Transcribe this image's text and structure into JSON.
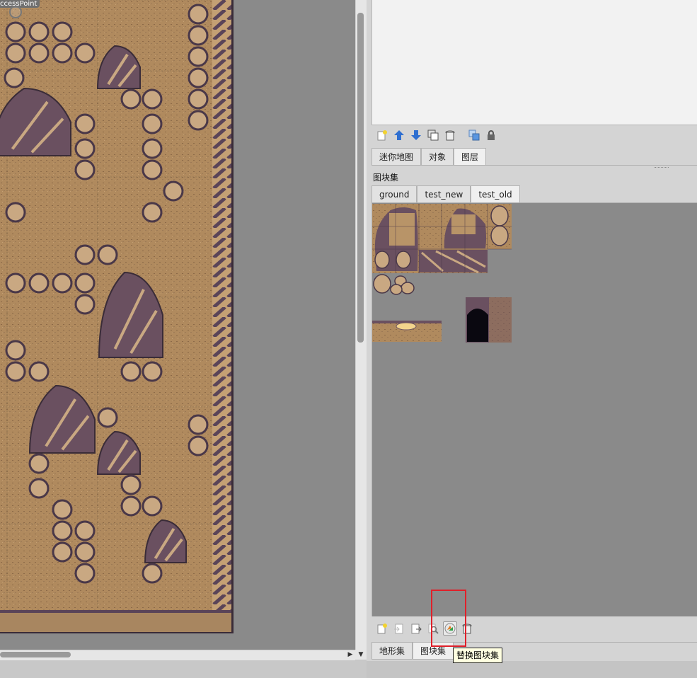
{
  "map": {
    "object_label": "ccessPoint"
  },
  "layers_toolbar": {
    "icons": [
      "new-layer-icon",
      "move-layer-up-icon",
      "move-layer-down-icon",
      "duplicate-layer-icon",
      "delete-layer-icon",
      "show-other-layers-icon",
      "lock-layer-icon"
    ]
  },
  "panel_tabs": [
    {
      "label": "迷你地图",
      "active": false
    },
    {
      "label": "对象",
      "active": false
    },
    {
      "label": "图层",
      "active": true
    }
  ],
  "tilesets": {
    "title": "图块集",
    "tabs": [
      {
        "label": "ground",
        "active": false
      },
      {
        "label": "test_new",
        "active": false
      },
      {
        "label": "test_old",
        "active": true
      }
    ]
  },
  "tileset_toolbar": {
    "icons": [
      "new-tileset-icon",
      "import-tileset-icon",
      "export-tileset-icon",
      "edit-tileset-icon",
      "replace-tileset-icon",
      "remove-tileset-icon"
    ],
    "tooltip": "替换图块集"
  },
  "bottom_tabs": [
    {
      "label": "地形集",
      "active": false
    },
    {
      "label": "图块集",
      "active": true
    }
  ],
  "colors": {
    "sand": "#b08a5e",
    "sand_dark": "#8c6a48",
    "rock": "#6a5060",
    "rock_light": "#c9a882",
    "highlight": "#e0202a",
    "tooltip_bg": "#ffffe1"
  }
}
